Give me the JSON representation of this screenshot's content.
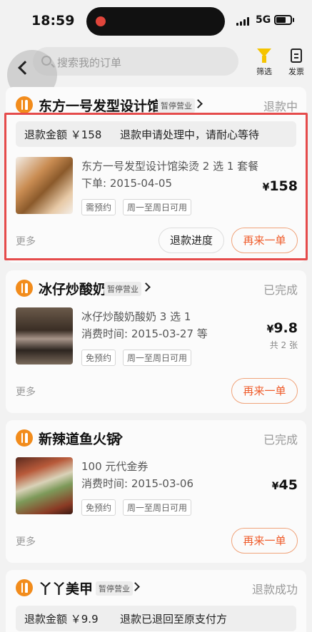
{
  "status_bar": {
    "time": "18:59",
    "network": "5G"
  },
  "top_nav": {
    "search_placeholder": "搜索我的订单",
    "filter_label": "筛选",
    "invoice_label": "发票"
  },
  "orders": [
    {
      "shop_name": "东方一号发型设计馆",
      "suspend_tag": "暂停营业",
      "status": "退款中",
      "refund_amount_text": "退款金额 ￥158",
      "refund_note": "退款申请处理中，请耐心等待",
      "item_title": "东方一号发型设计馆染烫 2 选 1 套餐",
      "item_date": "下单: 2015-04-05",
      "tags": [
        "需预约",
        "周一至周日可用"
      ],
      "price_symbol": "¥",
      "price_value": "158",
      "more": "更多",
      "btn_progress": "退款进度",
      "btn_reorder": "再来一单"
    },
    {
      "shop_name": "冰仔炒酸奶",
      "suspend_tag": "暂停营业",
      "status": "已完成",
      "item_title": "冰仔炒酸奶酸奶 3 选 1",
      "item_date": "消费时间: 2015-03-27 等",
      "tags": [
        "免预约",
        "周一至周日可用"
      ],
      "price_symbol": "¥",
      "price_value": "9.8",
      "qty": "共 2 张",
      "more": "更多",
      "btn_reorder": "再来一单"
    },
    {
      "shop_name": "新辣道鱼火锅",
      "status": "已完成",
      "item_title": "100 元代金券",
      "item_date": "消费时间: 2015-03-06",
      "tags": [
        "免预约",
        "周一至周日可用"
      ],
      "price_symbol": "¥",
      "price_value": "45",
      "more": "更多",
      "btn_reorder": "再来一单"
    },
    {
      "shop_name": "丫丫美甲",
      "suspend_tag": "暂停营业",
      "status": "退款成功",
      "refund_amount_text": "退款金额 ￥9.9",
      "refund_note": "退款已退回至原支付方"
    }
  ],
  "colors": {
    "accent_orange": "#ef5b2a",
    "logo_orange": "#f28c1c",
    "filter_yellow": "#f5c400",
    "highlight_red": "#e54b4b"
  }
}
